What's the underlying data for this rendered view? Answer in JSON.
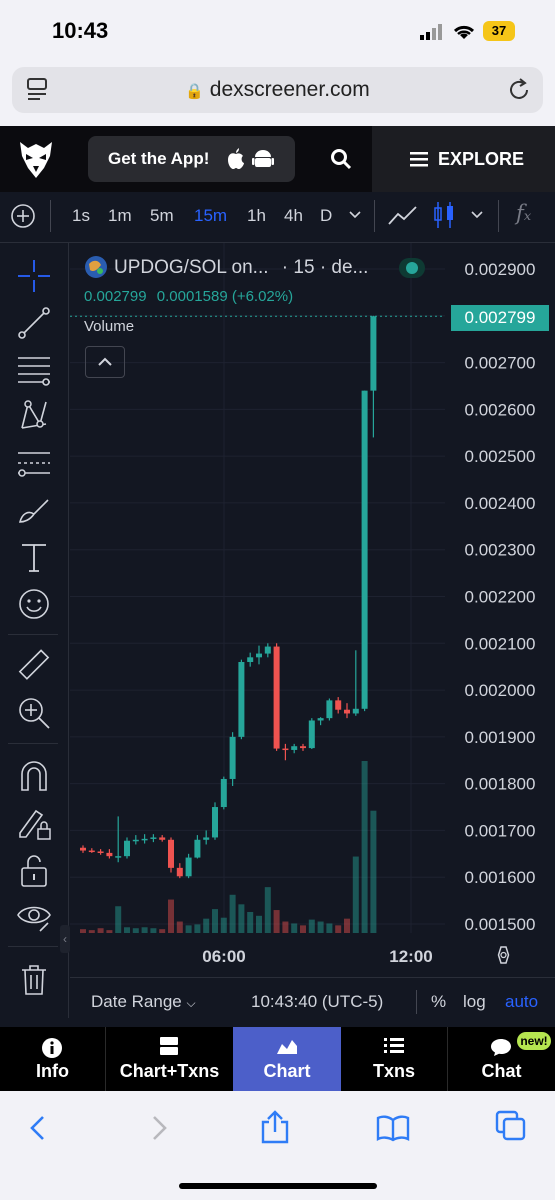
{
  "status": {
    "time": "10:43",
    "battery": "37"
  },
  "browser": {
    "url": "dexscreener.com"
  },
  "header": {
    "get_app_label": "Get the App!",
    "explore_label": "EXPLORE"
  },
  "timeframes": [
    "1s",
    "1m",
    "5m",
    "15m",
    "1h",
    "4h",
    "D"
  ],
  "active_timeframe": "15m",
  "legend": {
    "pair": "UPDOG/SOL on...",
    "interval": "· 15 · de...",
    "last_price": "0.002799",
    "change": "0.0001589 (+6.02%)",
    "volume_label": "Volume"
  },
  "price_axis": [
    "0.002900",
    "0.002800",
    "0.002700",
    "0.002600",
    "0.002500",
    "0.002400",
    "0.002300",
    "0.002200",
    "0.002100",
    "0.002000",
    "0.001900",
    "0.001800",
    "0.001700",
    "0.001600",
    "0.001500"
  ],
  "current_price_tag": "0.002799",
  "time_axis": [
    "06:00",
    "12:00"
  ],
  "bottom_bar": {
    "date_range": "Date Range",
    "clock": "10:43:40 (UTC-5)",
    "percent": "%",
    "log": "log",
    "auto": "auto"
  },
  "nav": [
    {
      "label": "Info"
    },
    {
      "label": "Chart+Txns"
    },
    {
      "label": "Chart"
    },
    {
      "label": "Txns"
    },
    {
      "label": "Chat"
    }
  ],
  "new_badge": "new!",
  "colors": {
    "up": "#26a69a",
    "down": "#ef5350",
    "accent": "#2962ff",
    "nav_active": "#4c5fc9"
  },
  "chart_data": {
    "type": "candlestick",
    "ylim": [
      0.0015,
      0.0029
    ],
    "candles": [
      {
        "o": 0.001663,
        "h": 0.001668,
        "l": 0.001652,
        "c": 0.001657
      },
      {
        "o": 0.001657,
        "h": 0.001662,
        "l": 0.001652,
        "c": 0.001655
      },
      {
        "o": 0.001655,
        "h": 0.00166,
        "l": 0.001648,
        "c": 0.001652
      },
      {
        "o": 0.001652,
        "h": 0.00166,
        "l": 0.00164,
        "c": 0.001645
      },
      {
        "o": 0.001645,
        "h": 0.00173,
        "l": 0.001632,
        "c": 0.001645
      },
      {
        "o": 0.001645,
        "h": 0.001685,
        "l": 0.00164,
        "c": 0.001678
      },
      {
        "o": 0.001678,
        "h": 0.00169,
        "l": 0.00167,
        "c": 0.00168
      },
      {
        "o": 0.00168,
        "h": 0.001692,
        "l": 0.001672,
        "c": 0.001682
      },
      {
        "o": 0.001682,
        "h": 0.001692,
        "l": 0.001675,
        "c": 0.001685
      },
      {
        "o": 0.001685,
        "h": 0.00169,
        "l": 0.001676,
        "c": 0.00168
      },
      {
        "o": 0.00168,
        "h": 0.001685,
        "l": 0.00161,
        "c": 0.00162
      },
      {
        "o": 0.00162,
        "h": 0.00163,
        "l": 0.001598,
        "c": 0.001602
      },
      {
        "o": 0.001602,
        "h": 0.00165,
        "l": 0.001598,
        "c": 0.001642
      },
      {
        "o": 0.001642,
        "h": 0.00169,
        "l": 0.00164,
        "c": 0.00168
      },
      {
        "o": 0.00168,
        "h": 0.0017,
        "l": 0.00167,
        "c": 0.001685
      },
      {
        "o": 0.001685,
        "h": 0.00176,
        "l": 0.00168,
        "c": 0.00175
      },
      {
        "o": 0.00175,
        "h": 0.001815,
        "l": 0.001745,
        "c": 0.00181
      },
      {
        "o": 0.00181,
        "h": 0.00191,
        "l": 0.001795,
        "c": 0.0019
      },
      {
        "o": 0.0019,
        "h": 0.002065,
        "l": 0.001895,
        "c": 0.00206
      },
      {
        "o": 0.00206,
        "h": 0.00208,
        "l": 0.00205,
        "c": 0.00207
      },
      {
        "o": 0.00207,
        "h": 0.002095,
        "l": 0.002055,
        "c": 0.002078
      },
      {
        "o": 0.002078,
        "h": 0.0021,
        "l": 0.00207,
        "c": 0.002093
      },
      {
        "o": 0.002093,
        "h": 0.0021,
        "l": 0.00187,
        "c": 0.001875
      },
      {
        "o": 0.001875,
        "h": 0.001885,
        "l": 0.00185,
        "c": 0.001872
      },
      {
        "o": 0.001872,
        "h": 0.001885,
        "l": 0.001865,
        "c": 0.00188
      },
      {
        "o": 0.00188,
        "h": 0.001885,
        "l": 0.00187,
        "c": 0.001876
      },
      {
        "o": 0.001876,
        "h": 0.00194,
        "l": 0.001874,
        "c": 0.001935
      },
      {
        "o": 0.001935,
        "h": 0.001942,
        "l": 0.001925,
        "c": 0.00194
      },
      {
        "o": 0.00194,
        "h": 0.001982,
        "l": 0.001935,
        "c": 0.001978
      },
      {
        "o": 0.001978,
        "h": 0.001985,
        "l": 0.00195,
        "c": 0.001958
      },
      {
        "o": 0.001958,
        "h": 0.001972,
        "l": 0.00194,
        "c": 0.00195
      },
      {
        "o": 0.00195,
        "h": 0.002085,
        "l": 0.001945,
        "c": 0.00196
      },
      {
        "o": 0.00196,
        "h": 0.00264,
        "l": 0.001955,
        "c": 0.00264
      },
      {
        "o": 0.00264,
        "h": 0.0028,
        "l": 0.00254,
        "c": 0.002799
      }
    ],
    "volumes": [
      4,
      3,
      5,
      3,
      28,
      6,
      5,
      6,
      5,
      4,
      35,
      12,
      8,
      9,
      15,
      25,
      16,
      40,
      30,
      22,
      18,
      48,
      24,
      12,
      10,
      8,
      14,
      12,
      10,
      8,
      15,
      80,
      180,
      128
    ],
    "x_ticks": [
      "06:00",
      "12:00"
    ]
  }
}
